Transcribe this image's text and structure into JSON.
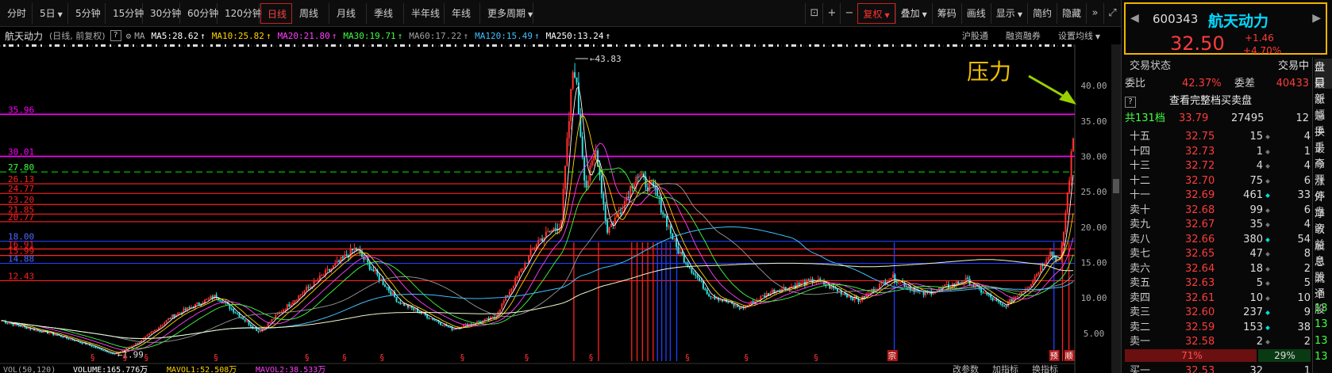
{
  "toolbar": {
    "periods": [
      {
        "label": "分时",
        "w": 40
      },
      {
        "label": "5日",
        "w": 44,
        "dd": true
      },
      {
        "label": "5分钟",
        "w": 46
      },
      {
        "label": "15分钟",
        "w": 46
      },
      {
        "label": "30分钟",
        "w": 46
      },
      {
        "label": "60分钟",
        "w": 46
      },
      {
        "label": "120分钟",
        "w": 52
      },
      {
        "label": "日线",
        "w": 40,
        "active": true
      },
      {
        "label": "周线",
        "w": 46
      },
      {
        "label": "月线",
        "w": 46
      },
      {
        "label": "季线",
        "w": 46
      },
      {
        "label": "半年线",
        "w": 50
      },
      {
        "label": "年线",
        "w": 44
      },
      {
        "label": "更多周期",
        "w": 66,
        "dd": true
      }
    ],
    "right_buttons": [
      {
        "label": "复权",
        "active": true,
        "dd": true
      },
      {
        "label": "叠加",
        "dd": true
      },
      {
        "label": "筹码"
      },
      {
        "label": "画线"
      },
      {
        "label": "显示",
        "dd": true
      },
      {
        "label": "简约"
      },
      {
        "label": "隐藏"
      }
    ]
  },
  "info": {
    "stock_name": "航天动力",
    "sub": "(日线, 前复权)",
    "ma_label": "MA",
    "ma": [
      {
        "text": "MA5:28.62",
        "color": "#ffffff"
      },
      {
        "text": "MA10:25.82",
        "color": "#ffd400"
      },
      {
        "text": "MA20:21.80",
        "color": "#ff40ff"
      },
      {
        "text": "MA30:19.71",
        "color": "#40ff40"
      },
      {
        "text": "MA60:17.22",
        "color": "#a0a0a0"
      },
      {
        "text": "MA120:15.49",
        "color": "#40c0ff"
      },
      {
        "text": "MA250:13.24",
        "color": "#ffffff"
      }
    ],
    "links": [
      "沪股通",
      "融资融券",
      "设置均线"
    ]
  },
  "chart": {
    "annotation": "压力",
    "high_label": "43.83",
    "low_label": "1.99",
    "ylim": [
      2.4,
      44.5
    ],
    "y_ticks": [
      "40.00",
      "35.00",
      "30.00",
      "25.00",
      "20.00",
      "15.00",
      "10.00",
      "5.00"
    ],
    "y_tick_values": [
      40,
      35,
      30,
      25,
      20,
      15,
      10,
      5
    ],
    "levels": [
      {
        "label": "35.96",
        "value": 35.96,
        "color": "#ff00ff"
      },
      {
        "label": "30.01",
        "value": 30.01,
        "color": "#ff00ff"
      },
      {
        "label": "27.80",
        "value": 27.8,
        "color": "#00c000",
        "dashed": true
      },
      {
        "label": "26.13",
        "value": 26.13,
        "color": "#ff2020"
      },
      {
        "label": "24.77",
        "value": 24.77,
        "color": "#ff2020"
      },
      {
        "label": "23.20",
        "value": 23.2,
        "color": "#ff2020"
      },
      {
        "label": "21.85",
        "value": 21.85,
        "color": "#ff2020"
      },
      {
        "label": "20.77",
        "value": 20.77,
        "color": "#ff2020"
      },
      {
        "label": "18.00",
        "value": 18.0,
        "color": "#2040ff"
      },
      {
        "label": "16.91",
        "value": 16.91,
        "color": "#ff2020"
      },
      {
        "label": "15.99",
        "value": 15.99,
        "color": "#ff2020"
      },
      {
        "label": "14.88",
        "value": 14.88,
        "color": "#2040ff"
      },
      {
        "label": "12.43",
        "value": 12.43,
        "color": "#ff2020"
      }
    ],
    "price_path": [
      [
        0,
        6.8
      ],
      [
        0.02,
        5.9
      ],
      [
        0.05,
        4.8
      ],
      [
        0.08,
        3.4
      ],
      [
        0.105,
        2.0
      ],
      [
        0.13,
        3.9
      ],
      [
        0.16,
        7.5
      ],
      [
        0.2,
        10.3
      ],
      [
        0.24,
        5.2
      ],
      [
        0.275,
        10.0
      ],
      [
        0.33,
        17.0
      ],
      [
        0.37,
        9.5
      ],
      [
        0.42,
        5.6
      ],
      [
        0.46,
        7.2
      ],
      [
        0.5,
        18.0
      ],
      [
        0.522,
        20.5
      ],
      [
        0.534,
        43.83
      ],
      [
        0.545,
        25.5
      ],
      [
        0.555,
        31.0
      ],
      [
        0.565,
        19.5
      ],
      [
        0.578,
        22.5
      ],
      [
        0.592,
        27.5
      ],
      [
        0.61,
        25.0
      ],
      [
        0.63,
        17.0
      ],
      [
        0.66,
        10.5
      ],
      [
        0.69,
        8.5
      ],
      [
        0.72,
        11.0
      ],
      [
        0.76,
        12.5
      ],
      [
        0.8,
        9.6
      ],
      [
        0.83,
        13.0
      ],
      [
        0.86,
        10.5
      ],
      [
        0.9,
        12.5
      ],
      [
        0.935,
        8.7
      ],
      [
        0.96,
        12.0
      ],
      [
        0.978,
        16.5
      ],
      [
        0.988,
        15.0
      ],
      [
        1.0,
        32.5
      ]
    ],
    "bottom_bar": [
      "VOL(50,120)",
      "VOLUME:165.776万",
      "MAVOL1:52.508万",
      "MAVOL2:38.533万"
    ],
    "bottom_right": [
      "改参数",
      "加指标",
      "换指标"
    ],
    "event_marks": [
      "宗",
      "预",
      "顺"
    ]
  },
  "quote": {
    "code": "600343",
    "name": "航天动力",
    "price": "32.50",
    "change": "+1.46",
    "pct": "+4.70%"
  },
  "panel": {
    "status_label": "交易状态",
    "status_value": "交易中",
    "wb_label": "委比",
    "wb_value": "42.37%",
    "wc_label": "委差",
    "wc_value": "40433",
    "full_book_btn": "查看完整档买卖盘",
    "q_icon": "?",
    "total_label": "共131档",
    "total_price": "33.79",
    "total_vol": "27495",
    "total_cnt": "12",
    "ask": [
      {
        "lv": "十五",
        "px": "32.75",
        "vol": "15",
        "cnt": "4",
        "dot": "#777"
      },
      {
        "lv": "十四",
        "px": "32.73",
        "vol": "1",
        "cnt": "1",
        "dot": "#777"
      },
      {
        "lv": "十三",
        "px": "32.72",
        "vol": "4",
        "cnt": "4",
        "dot": "#777"
      },
      {
        "lv": "十二",
        "px": "32.70",
        "vol": "75",
        "cnt": "6",
        "dot": "#777"
      },
      {
        "lv": "十一",
        "px": "32.69",
        "vol": "461",
        "cnt": "33",
        "dot": "#00e0e0"
      },
      {
        "lv": "卖十",
        "px": "32.68",
        "vol": "99",
        "cnt": "6",
        "dot": "#777"
      },
      {
        "lv": "卖九",
        "px": "32.67",
        "vol": "35",
        "cnt": "4",
        "dot": "#777"
      },
      {
        "lv": "卖八",
        "px": "32.66",
        "vol": "380",
        "cnt": "54",
        "dot": "#00e0e0"
      },
      {
        "lv": "卖七",
        "px": "32.65",
        "vol": "47",
        "cnt": "8",
        "dot": "#777"
      },
      {
        "lv": "卖六",
        "px": "32.64",
        "vol": "18",
        "cnt": "2",
        "dot": "#777"
      },
      {
        "lv": "卖五",
        "px": "32.63",
        "vol": "5",
        "cnt": "5",
        "dot": "#777"
      },
      {
        "lv": "卖四",
        "px": "32.61",
        "vol": "10",
        "cnt": "10",
        "dot": "#777"
      },
      {
        "lv": "卖三",
        "px": "32.60",
        "vol": "237",
        "cnt": "9",
        "dot": "#00e0e0"
      },
      {
        "lv": "卖二",
        "px": "32.59",
        "vol": "153",
        "cnt": "38",
        "dot": "#00e0e0"
      },
      {
        "lv": "卖一",
        "px": "32.58",
        "vol": "2",
        "cnt": "2",
        "dot": "#777"
      }
    ],
    "bar_left": "71%",
    "bar_left_value": 0.71,
    "bar_right": "29%",
    "buy1": {
      "lv": "买一",
      "px": "32.53",
      "vol": "32",
      "cnt": "1"
    },
    "side_tabs": [
      "盘口",
      "最新",
      "涨幅",
      "总手",
      "换手",
      "最高",
      "今开",
      "涨停",
      "外盘",
      "净资",
      "收益",
      "股息",
      "总股",
      "流通",
      "个股",
      "13",
      "13",
      "13",
      "13"
    ]
  }
}
